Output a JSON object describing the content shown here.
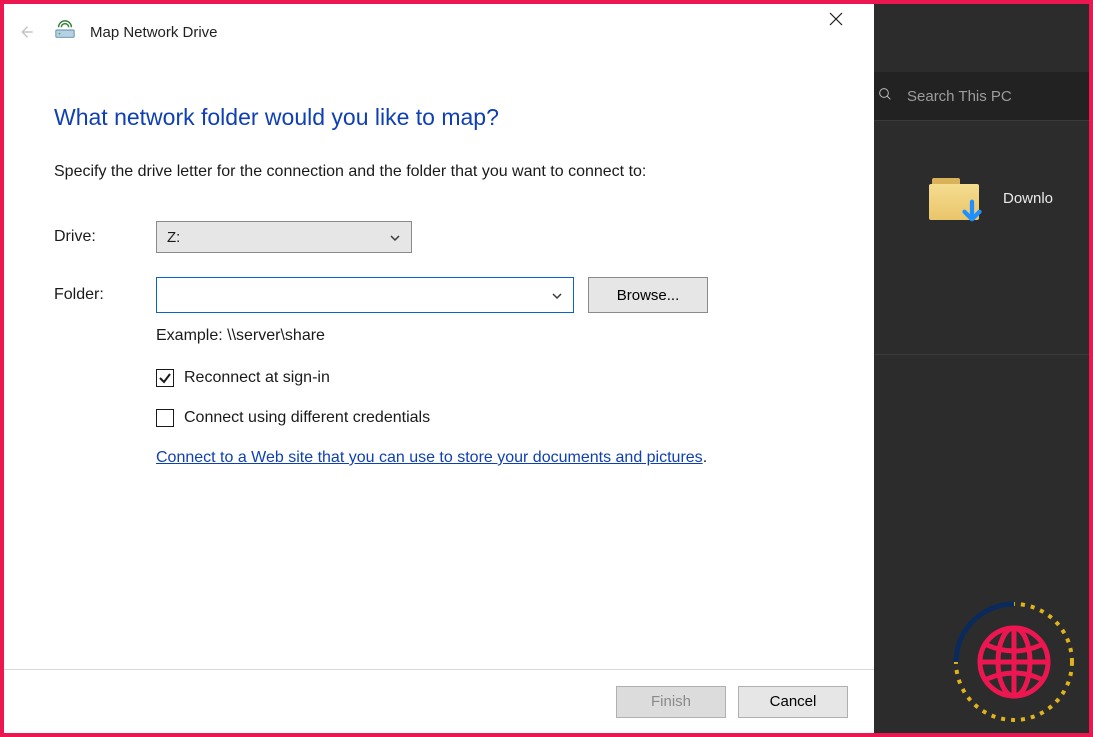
{
  "dialog": {
    "title": "Map Network Drive",
    "heading": "What network folder would you like to map?",
    "instruction": "Specify the drive letter for the connection and the folder that you want to connect to:",
    "drive_label": "Drive:",
    "drive_value": "Z:",
    "folder_label": "Folder:",
    "folder_value": "",
    "browse_label": "Browse...",
    "example_text": "Example: \\\\server\\share",
    "reconnect_label": "Reconnect at sign-in",
    "reconnect_checked": true,
    "diffcreds_label": "Connect using different credentials",
    "diffcreds_checked": false,
    "link_text": "Connect to a Web site that you can use to store your documents and pictures",
    "link_suffix": ".",
    "finish_label": "Finish",
    "cancel_label": "Cancel"
  },
  "explorer": {
    "search_placeholder": "Search This PC",
    "downloads_label": "Downlo"
  }
}
